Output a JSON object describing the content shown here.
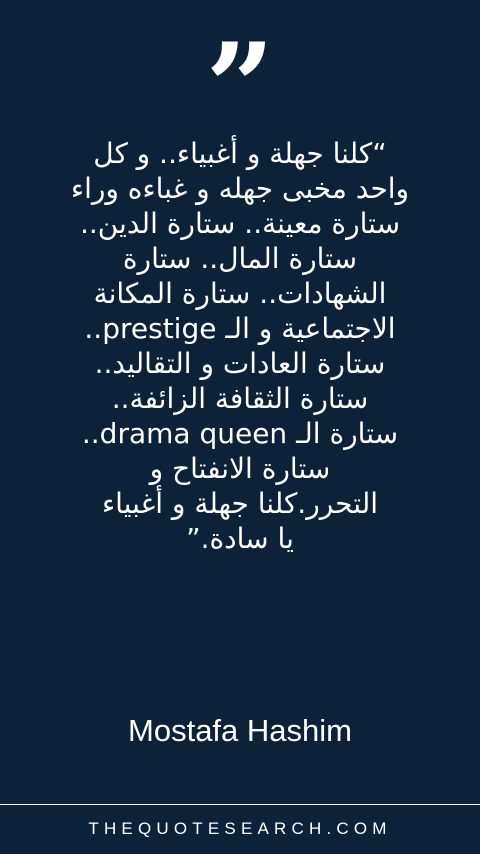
{
  "icons": {
    "quote": "quote-mark-icon"
  },
  "quote": {
    "text": "“كلنا جهلة و أغبياء.. و كل\nواحد مخبى جهله و غباءه وراء\nستارة معينة.. ستارة الدين..\nستارة المال.. ستارة\nالشهادات.. ستارة المكانة\nالاجتماعية و الـ prestige..\nستارة العادات و التقاليد..\nستارة الثقافة الزائفة..\nستارة الـ drama queen..\nستارة الانفتاح و\nالتحرر.كلنا جهلة و أغبياء\nيا سادة.”"
  },
  "author": {
    "name": "Mostafa Hashim"
  },
  "footer": {
    "site": "THEQUOTESEARCH.COM"
  },
  "colors": {
    "background": "#0d2139",
    "text": "#ffffff"
  }
}
